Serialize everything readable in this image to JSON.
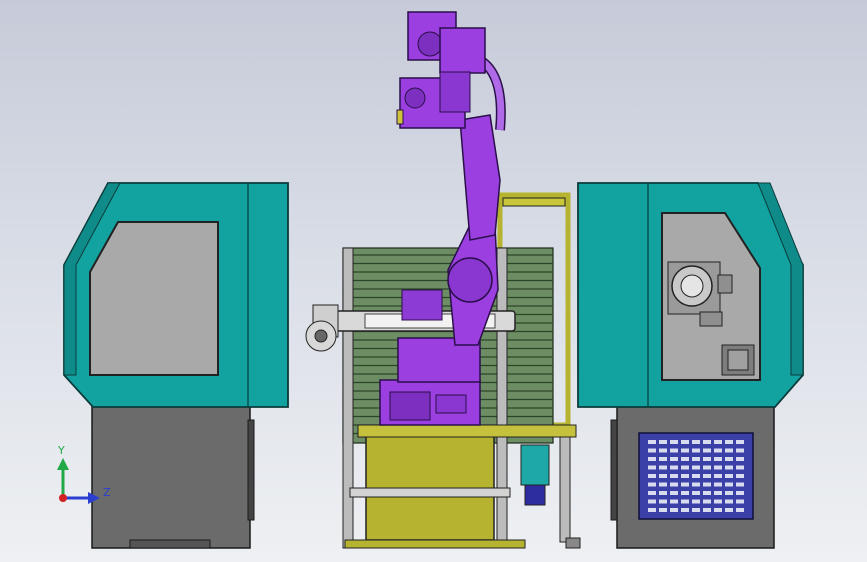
{
  "viewport": {
    "background_top": "#c7cbd9",
    "background_bottom": "#eef0f3"
  },
  "colors": {
    "cabinet_teal": "#12a3a0",
    "cabinet_edge": "#0e6f6e",
    "window_gray": "#a9a9a9",
    "base_gray": "#6b6b6b",
    "robot_purple": "#9b3fe0",
    "robot_dark": "#5a1f94",
    "frame_yellow": "#b5b330",
    "fixture_green": "#5f8f5a",
    "vent_blue": "#3b3fa8"
  },
  "triad": {
    "y_label": "Y",
    "z_label": "Z",
    "y_color": "#22a845",
    "z_color": "#2a3fd1",
    "x_color": "#d32020"
  },
  "icons": {
    "triad": "coordinate-triad-icon"
  }
}
